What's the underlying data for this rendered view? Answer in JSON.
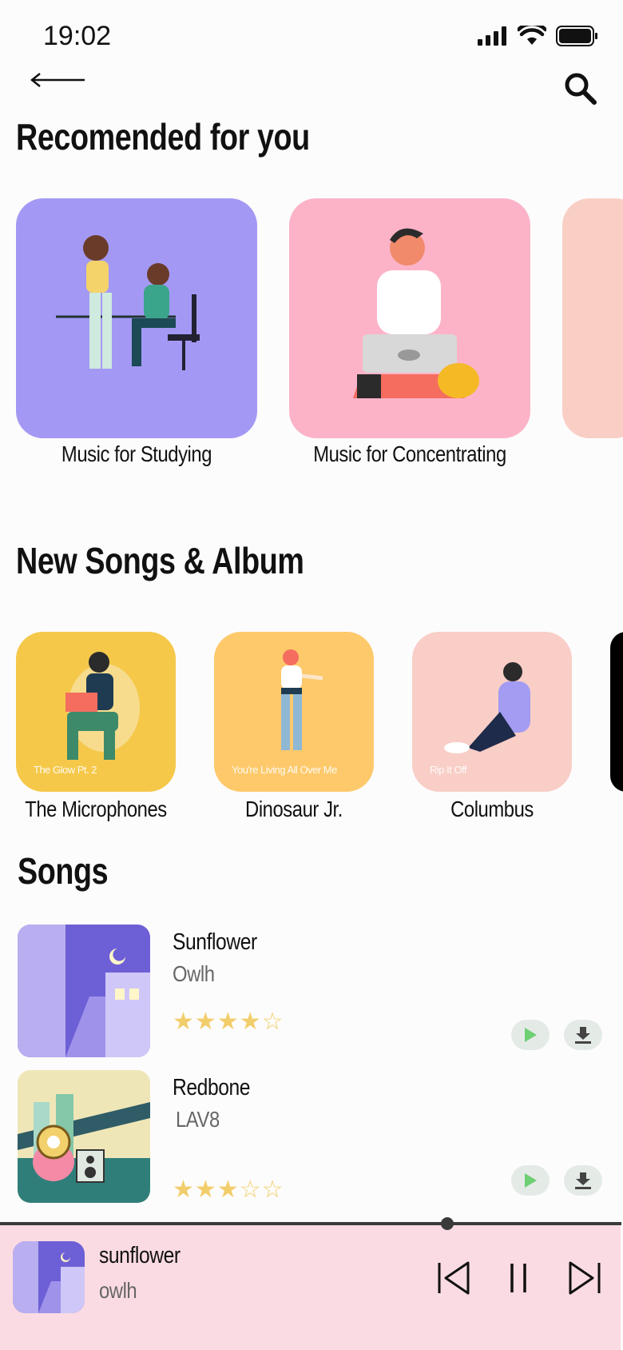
{
  "status": {
    "time": "19:02"
  },
  "header": {
    "back_icon": "arrow-left-icon",
    "search_icon": "search-icon"
  },
  "recommended": {
    "title": "Recomended for you",
    "items": [
      {
        "label": "Music for Studying",
        "color": "#a399f4"
      },
      {
        "label": "Music for Concentrating",
        "color": "#fcb3c8"
      }
    ]
  },
  "new_songs": {
    "title": "New Songs & Album",
    "items": [
      {
        "subtitle": "The Glow Pt. 2",
        "label": "The Microphones",
        "color": "#f5c84a"
      },
      {
        "subtitle": "You're Living All Over Me",
        "label": "Dinosaur Jr.",
        "color": "#fdc96b"
      },
      {
        "subtitle": "Rip It Off",
        "label": "Columbus",
        "color": "#f8cec7"
      }
    ]
  },
  "songs": {
    "title": "Songs",
    "items": [
      {
        "title": "Sunflower",
        "artist": "Owlh",
        "rating": 4,
        "max_rating": 5
      },
      {
        "title": "Redbone",
        "artist": "LAV8",
        "rating": 3,
        "max_rating": 5
      }
    ]
  },
  "player": {
    "title": "sunflower",
    "artist": "owlh",
    "progress": 0.72
  },
  "colors": {
    "accent_green": "#6fcf73",
    "player_bg": "#fbdbe3",
    "star": "#f1cd6b"
  }
}
